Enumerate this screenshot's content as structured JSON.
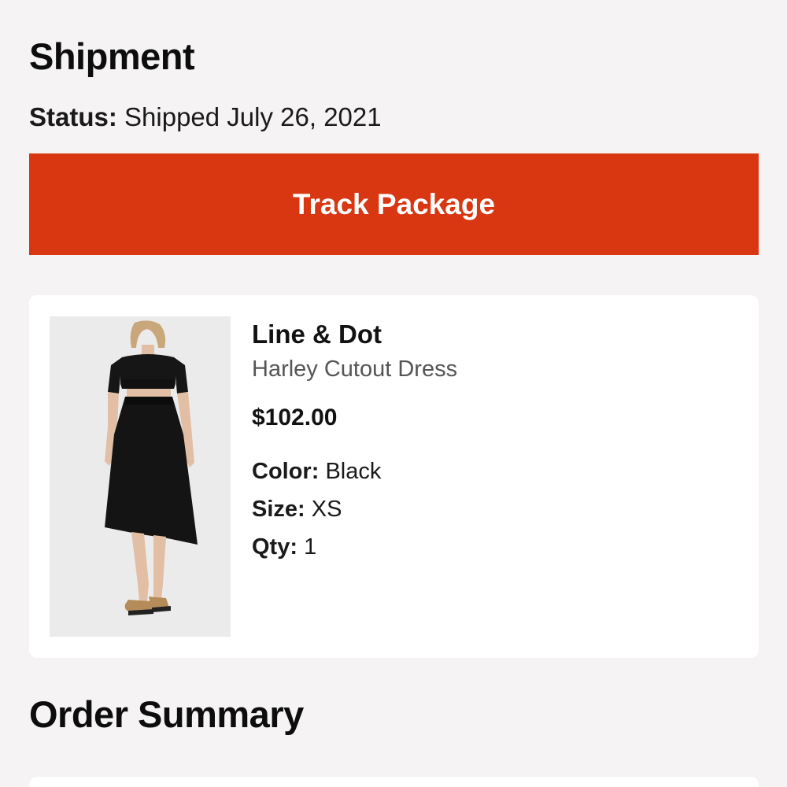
{
  "shipment": {
    "title": "Shipment",
    "status_label": "Status:",
    "status_value": "Shipped July 26, 2021",
    "track_button_label": "Track Package"
  },
  "item": {
    "image_icon": "product-photo",
    "brand": "Line & Dot",
    "name": "Harley Cutout Dress",
    "price": "$102.00",
    "color_label": "Color:",
    "color_value": "Black",
    "size_label": "Size:",
    "size_value": "XS",
    "qty_label": "Qty:",
    "qty_value": "1"
  },
  "order_summary": {
    "title": "Order Summary"
  },
  "colors": {
    "accent": "#d93612",
    "background": "#f5f3f4",
    "card": "#ffffff"
  }
}
